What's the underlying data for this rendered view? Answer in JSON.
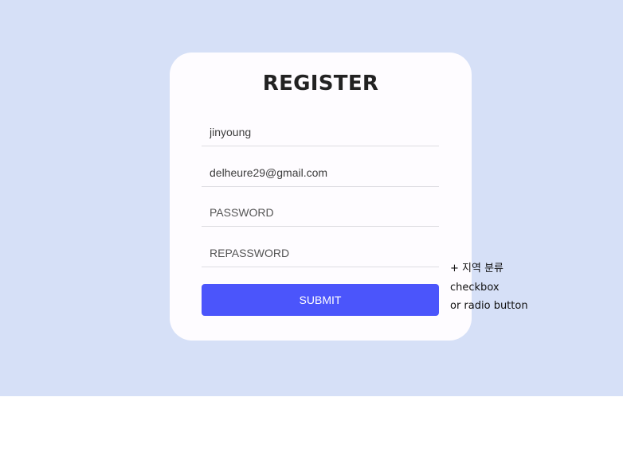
{
  "form": {
    "title": "REGISTER",
    "username_value": "jinyoung",
    "email_value": "delheure29@gmail.com",
    "password_placeholder": "PASSWORD",
    "repassword_placeholder": "REPASSWORD",
    "submit_label": "SUBMIT"
  },
  "note": {
    "lines": [
      "+ 지역 분류",
      "checkbox",
      "or radio button"
    ]
  },
  "colors": {
    "backdrop": "#d6e0f7",
    "card": "#fefcff",
    "submit_button": "#4b55fb"
  }
}
